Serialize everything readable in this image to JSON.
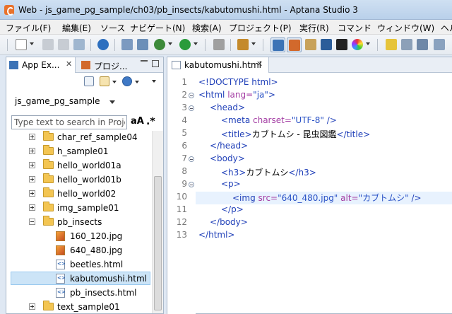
{
  "window": {
    "title": "Web - js_game_pg_sample/ch03/pb_insects/kabutomushi.html - Aptana Studio 3"
  },
  "menubar": {
    "items": [
      "ファイル(F)",
      "編集(E)",
      "ソース",
      "ナビゲート(N)",
      "検索(A)",
      "プロジェクト(P)",
      "実行(R)",
      "コマンド",
      "ウィンドウ(W)",
      "ヘル"
    ]
  },
  "left_panel": {
    "tabs": [
      "App Ex...",
      "プロジ..."
    ],
    "project": "js_game_pg_sample",
    "search_placeholder": "Type text to search in Project",
    "case_toggle": "aA",
    "regex_toggle": ".*",
    "tree": [
      {
        "label": "char_ref_sample04",
        "type": "folder",
        "expanded": false
      },
      {
        "label": "h_sample01",
        "type": "folder",
        "expanded": false
      },
      {
        "label": "hello_world01a",
        "type": "folder",
        "expanded": false
      },
      {
        "label": "hello_world01b",
        "type": "folder",
        "expanded": false
      },
      {
        "label": "hello_world02",
        "type": "folder",
        "expanded": false
      },
      {
        "label": "img_sample01",
        "type": "folder",
        "expanded": false
      },
      {
        "label": "pb_insects",
        "type": "folder",
        "expanded": true
      },
      {
        "label": "160_120.jpg",
        "type": "image"
      },
      {
        "label": "640_480.jpg",
        "type": "image"
      },
      {
        "label": "beetles.html",
        "type": "html"
      },
      {
        "label": "kabutomushi.html",
        "type": "html",
        "selected": true
      },
      {
        "label": "pb_insects.html",
        "type": "html"
      },
      {
        "label": "text_sample01",
        "type": "folder",
        "expanded": false
      }
    ]
  },
  "editor": {
    "tab_label": "kabutomushi.html",
    "line_numbers": [
      "1",
      "2",
      "3",
      "4",
      "5",
      "6",
      "7",
      "8",
      "9",
      "10",
      "11",
      "12",
      "13"
    ],
    "current_line": 10,
    "code": {
      "l1": "<!DOCTYPE html>",
      "l2_tag_open": "<html",
      "l2_attr": " lang=",
      "l2_val": "\"ja\"",
      "l2_close": ">",
      "l3": "<head>",
      "l4_tag_open": "<meta",
      "l4_attr": " charset=",
      "l4_val": "\"UTF-8\"",
      "l4_close": " />",
      "l5_open": "<title>",
      "l5_text": "カブトムシ - 昆虫図鑑",
      "l5_close": "</title>",
      "l6": "</head>",
      "l7": "<body>",
      "l8_open": "<h3>",
      "l8_text": "カブトムシ",
      "l8_close": "</h3>",
      "l9": "<p>",
      "l10_tag_open": "<img",
      "l10_attr1": " src=",
      "l10_val1": "\"640_480.jpg\"",
      "l10_attr2": " alt=",
      "l10_val2": "\"カブトムシ\"",
      "l10_close": " />",
      "l11": "</p>",
      "l12": "</body>",
      "l13": "</html>"
    }
  }
}
